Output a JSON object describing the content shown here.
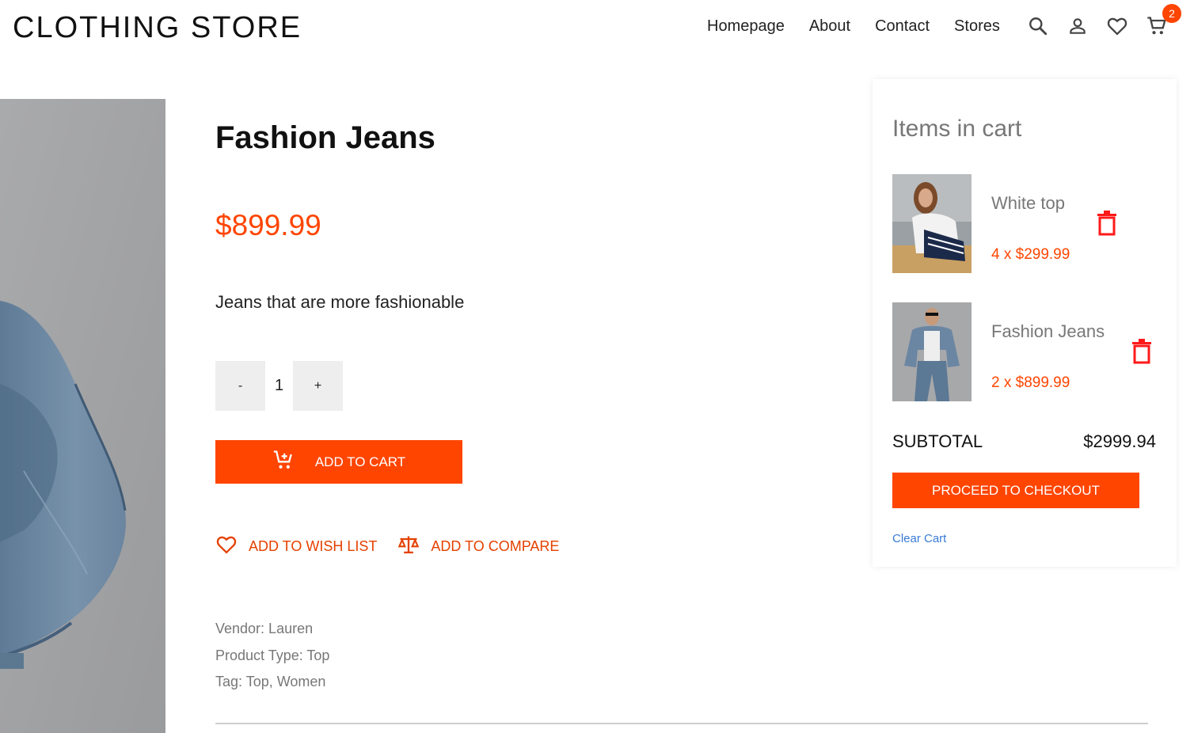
{
  "header": {
    "logo": "CLOTHING STORE",
    "nav": [
      "Homepage",
      "About",
      "Contact",
      "Stores"
    ],
    "cart_count": "2"
  },
  "product": {
    "title": "Fashion Jeans",
    "price": "$899.99",
    "description": "Jeans that are more fashionable",
    "quantity": "1",
    "minus_label": "-",
    "plus_label": "+",
    "add_to_cart_label": "ADD TO CART",
    "wishlist_label": "ADD TO WISH LIST",
    "compare_label": "ADD TO COMPARE",
    "vendor": "Vendor: Lauren",
    "product_type": "Product Type: Top",
    "tags": "Tag: Top, Women"
  },
  "cart": {
    "title": "Items in cart",
    "items": [
      {
        "name": "White top",
        "qty_price": "4 x $299.99"
      },
      {
        "name": "Fashion Jeans",
        "qty_price": "2 x $899.99"
      }
    ],
    "subtotal_label": "SUBTOTAL",
    "subtotal_value": "$2999.94",
    "checkout_label": "PROCEED TO CHECKOUT",
    "clear_label": "Clear Cart"
  },
  "colors": {
    "accent": "#ff4500",
    "link": "#3a7bd5"
  },
  "icons": [
    "search-icon",
    "user-icon",
    "heart-icon",
    "cart-icon",
    "add-cart-icon",
    "scale-icon",
    "trash-icon"
  ]
}
